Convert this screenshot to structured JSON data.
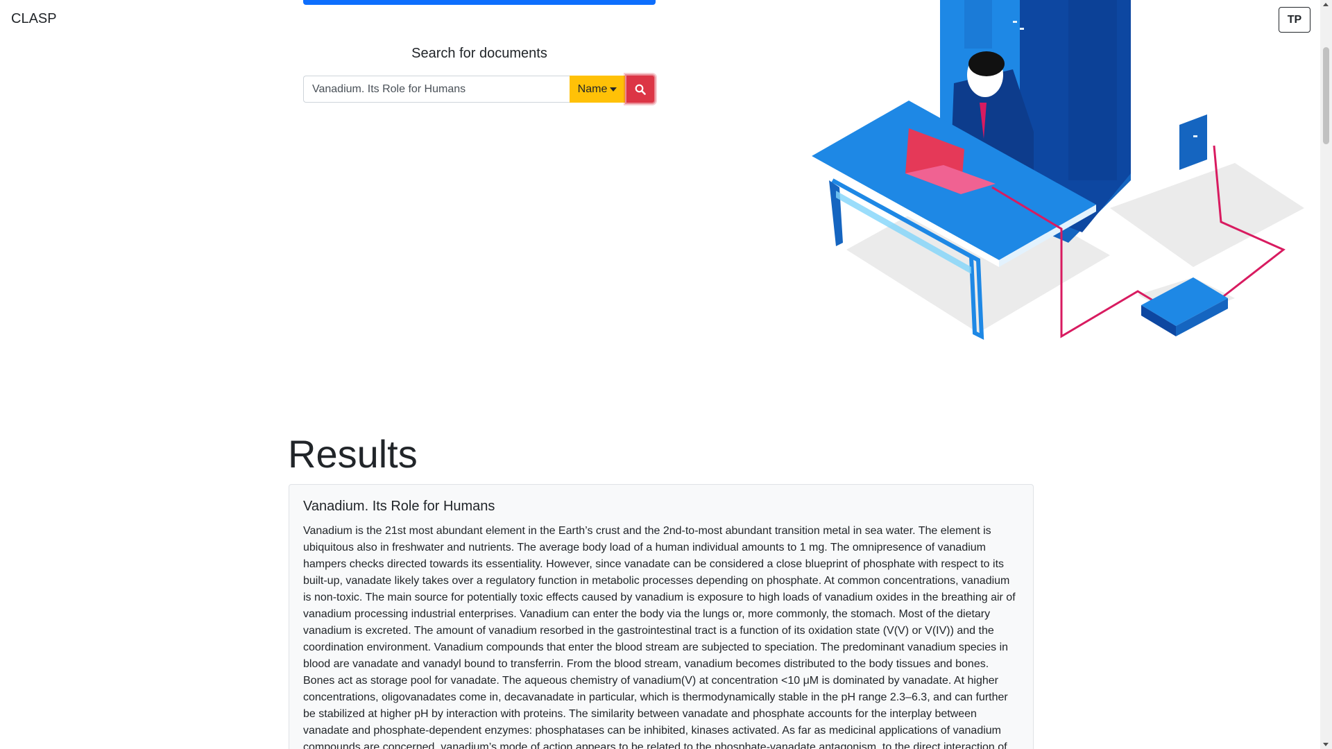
{
  "header": {
    "brand": "CLASP",
    "user_initials": "TP"
  },
  "search": {
    "title": "Search for documents",
    "query": "Vanadium. Its Role for Humans",
    "filter_label": "Name",
    "search_icon": "search-icon"
  },
  "results": {
    "heading": "Results",
    "items": [
      {
        "title": "Vanadium. Its Role for Humans",
        "abstract": "Vanadium is the 21st most abundant element in the Earth’s crust and the 2nd-to-most abundant transition metal in sea water. The element is ubiquitous also in freshwater and nutrients. The average body load of a human individual amounts to 1 mg. The omnipresence of vanadium hampers checks directed towards its essentiality. However, since vanadate can be considered a close blueprint of phosphate with respect to its built-up, vanadate likely takes over a regulatory function in metabolic processes depending on phosphate. At common concentrations, vanadium is non-toxic. The main source for potentially toxic effects caused by vanadium is exposure to high loads of vanadium oxides in the breathing air of vanadium processing industrial enterprises. Vanadium can enter the body via the lungs or, more commonly, the stomach. Most of the dietary vanadium is excreted. The amount of vanadium resorbed in the gastrointestinal tract is a function of its oxidation state (V(V) or V(IV)) and the coordination environment. Vanadium compounds that enter the blood stream are subjected to speciation. The predominant vanadium species in blood are vanadate and vanadyl bound to transferrin. From the blood stream, vanadium becomes distributed to the body tissues and bones. Bones act as storage pool for vanadate. The aqueous chemistry of vanadium(V) at concentration <10 μM is dominated by vanadate. At higher concentrations, oligovanadates come in, decavanadate in particular, which is thermodynamically stable in the pH range 2.3–6.3, and can further be stabilized at higher pH by interaction with proteins. The similarity between vanadate and phosphate accounts for the interplay between vanadate and phosphate-dependent enzymes: phosphatases can be inhibited, kinases activated. As far as medicinal applications of vanadium compounds are concerned, vanadium’s mode of action appears to be related to the phosphate-vanadate antagonism, to the direct interaction of"
      }
    ]
  },
  "colors": {
    "primary": "#0d6efd",
    "warning": "#ffc107",
    "danger": "#dc3545"
  }
}
